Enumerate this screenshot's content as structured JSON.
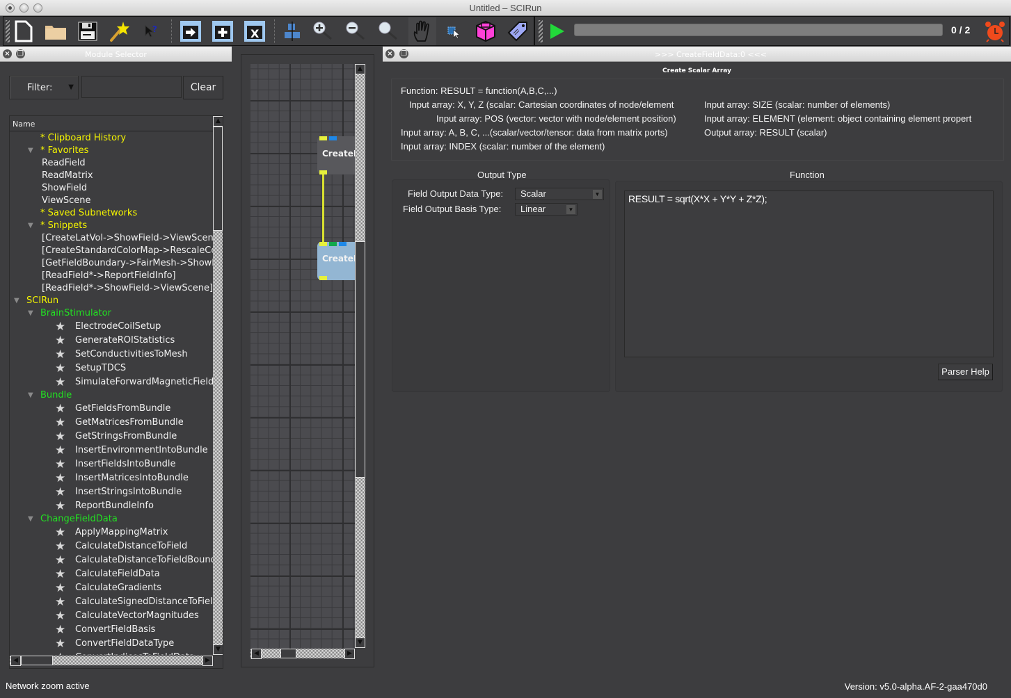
{
  "window": {
    "title": "Untitled – SCIRun"
  },
  "toolbar": {
    "buttons": [
      {
        "name": "new-network",
        "icon": "new-file-icon"
      },
      {
        "name": "open-network",
        "icon": "folder-icon"
      },
      {
        "name": "save-network",
        "icon": "floppy-disk-icon"
      },
      {
        "name": "wizard",
        "icon": "magic-wand-icon"
      },
      {
        "name": "whats-this",
        "icon": "help-cursor-icon"
      },
      {
        "name": "execute-module",
        "icon": "arrow-window-icon"
      },
      {
        "name": "add-module",
        "icon": "plus-window-icon"
      },
      {
        "name": "delete-module",
        "icon": "x-window-icon"
      },
      {
        "name": "align",
        "icon": "align-icon"
      },
      {
        "name": "zoom-in",
        "icon": "zoom-in-icon"
      },
      {
        "name": "zoom-out",
        "icon": "zoom-out-icon"
      },
      {
        "name": "zoom-reset",
        "icon": "magnifier-icon"
      },
      {
        "name": "pan",
        "icon": "hand-icon"
      },
      {
        "name": "select",
        "icon": "select-cursor-icon"
      },
      {
        "name": "subnet",
        "icon": "cube-icon"
      },
      {
        "name": "tag",
        "icon": "tag-icon"
      },
      {
        "name": "execute-all",
        "icon": "play-icon"
      }
    ],
    "progress": {
      "completed": 0,
      "total": 2,
      "fraction": 0.0
    },
    "counter_text": "0 / 2",
    "alarm_icon": "alarm-clock-icon"
  },
  "module_selector": {
    "title": "Module Selector",
    "filter_label": "Filter:",
    "filter_value": "",
    "clear_label": "Clear",
    "column_header": "Name",
    "items": [
      {
        "level": 1,
        "expander": false,
        "color": "yellow",
        "star": false,
        "label": "* Clipboard History"
      },
      {
        "level": 1,
        "expander": true,
        "color": "yellow",
        "star": false,
        "label": "* Favorites"
      },
      {
        "level": 2,
        "expander": false,
        "color": "white",
        "star": false,
        "label": "ReadField"
      },
      {
        "level": 2,
        "expander": false,
        "color": "white",
        "star": false,
        "label": "ReadMatrix"
      },
      {
        "level": 2,
        "expander": false,
        "color": "white",
        "star": false,
        "label": "ShowField"
      },
      {
        "level": 2,
        "expander": false,
        "color": "white",
        "star": false,
        "label": "ViewScene"
      },
      {
        "level": 1,
        "expander": false,
        "color": "yellow",
        "star": false,
        "label": "* Saved Subnetworks"
      },
      {
        "level": 1,
        "expander": true,
        "color": "yellow",
        "star": false,
        "label": "* Snippets"
      },
      {
        "level": 2,
        "expander": false,
        "color": "white",
        "star": false,
        "label": "[CreateLatVol->ShowField->ViewScene]"
      },
      {
        "level": 2,
        "expander": false,
        "color": "white",
        "star": false,
        "label": "[CreateStandardColorMap->RescaleColorMap]"
      },
      {
        "level": 2,
        "expander": false,
        "color": "white",
        "star": false,
        "label": "[GetFieldBoundary->FairMesh->ShowField]"
      },
      {
        "level": 2,
        "expander": false,
        "color": "white",
        "star": false,
        "label": "[ReadField*->ReportFieldInfo]"
      },
      {
        "level": 2,
        "expander": false,
        "color": "white",
        "star": false,
        "label": "[ReadField*->ShowField->ViewScene]"
      },
      {
        "level": 0,
        "expander": true,
        "color": "yellow",
        "star": false,
        "label": "SCIRun"
      },
      {
        "level": 1,
        "expander": true,
        "color": "green",
        "star": false,
        "label": "BrainStimulator"
      },
      {
        "level": 2,
        "expander": false,
        "color": "white",
        "star": true,
        "label": "ElectrodeCoilSetup"
      },
      {
        "level": 2,
        "expander": false,
        "color": "white",
        "star": true,
        "label": "GenerateROIStatistics"
      },
      {
        "level": 2,
        "expander": false,
        "color": "white",
        "star": true,
        "label": "SetConductivitiesToMesh"
      },
      {
        "level": 2,
        "expander": false,
        "color": "white",
        "star": true,
        "label": "SetupTDCS"
      },
      {
        "level": 2,
        "expander": false,
        "color": "white",
        "star": true,
        "label": "SimulateForwardMagneticField"
      },
      {
        "level": 1,
        "expander": true,
        "color": "green",
        "star": false,
        "label": "Bundle"
      },
      {
        "level": 2,
        "expander": false,
        "color": "white",
        "star": true,
        "label": "GetFieldsFromBundle"
      },
      {
        "level": 2,
        "expander": false,
        "color": "white",
        "star": true,
        "label": "GetMatricesFromBundle"
      },
      {
        "level": 2,
        "expander": false,
        "color": "white",
        "star": true,
        "label": "GetStringsFromBundle"
      },
      {
        "level": 2,
        "expander": false,
        "color": "white",
        "star": true,
        "label": "InsertEnvironmentIntoBundle"
      },
      {
        "level": 2,
        "expander": false,
        "color": "white",
        "star": true,
        "label": "InsertFieldsIntoBundle"
      },
      {
        "level": 2,
        "expander": false,
        "color": "white",
        "star": true,
        "label": "InsertMatricesIntoBundle"
      },
      {
        "level": 2,
        "expander": false,
        "color": "white",
        "star": true,
        "label": "InsertStringsIntoBundle"
      },
      {
        "level": 2,
        "expander": false,
        "color": "white",
        "star": true,
        "label": "ReportBundleInfo"
      },
      {
        "level": 1,
        "expander": true,
        "color": "green",
        "star": false,
        "label": "ChangeFieldData"
      },
      {
        "level": 2,
        "expander": false,
        "color": "white",
        "star": true,
        "label": "ApplyMappingMatrix"
      },
      {
        "level": 2,
        "expander": false,
        "color": "white",
        "star": true,
        "label": "CalculateDistanceToField"
      },
      {
        "level": 2,
        "expander": false,
        "color": "white",
        "star": true,
        "label": "CalculateDistanceToFieldBoundary"
      },
      {
        "level": 2,
        "expander": false,
        "color": "white",
        "star": true,
        "label": "CalculateFieldData"
      },
      {
        "level": 2,
        "expander": false,
        "color": "white",
        "star": true,
        "label": "CalculateGradients"
      },
      {
        "level": 2,
        "expander": false,
        "color": "white",
        "star": true,
        "label": "CalculateSignedDistanceToField"
      },
      {
        "level": 2,
        "expander": false,
        "color": "white",
        "star": true,
        "label": "CalculateVectorMagnitudes"
      },
      {
        "level": 2,
        "expander": false,
        "color": "white",
        "star": true,
        "label": "ConvertFieldBasis"
      },
      {
        "level": 2,
        "expander": false,
        "color": "white",
        "star": true,
        "label": "ConvertFieldDataType"
      },
      {
        "level": 2,
        "expander": false,
        "color": "white",
        "star": true,
        "label": "ConvertIndicesToFieldData"
      }
    ]
  },
  "network": {
    "nodes": [
      {
        "label": "CreateLatVol",
        "selected": false
      },
      {
        "label": "CreateFieldData",
        "selected": true
      }
    ],
    "colors": {
      "field_port": "#e6f03c",
      "matrix_port": "#1e88e8",
      "string_port": "#11a84a",
      "selected_node": "#93b6d3",
      "node": "#58585c"
    }
  },
  "module_ui": {
    "title": ">>> CreateFieldData:0 <<<",
    "subtitle": "Create Scalar Array",
    "doc_left": [
      "Function: RESULT = function(A,B,C,...)",
      "Input array: X, Y, Z (scalar: Cartesian coordinates of node/element",
      "Input array: POS (vector: vector with node/element position)",
      "Input array: A, B, C, ...(scalar/vector/tensor: data from matrix ports)",
      "Input array: INDEX (scalar: number of the element)"
    ],
    "doc_right": [
      "Input array: SIZE (scalar: number of elements)",
      "Input array: ELEMENT (element: object containing element propert",
      "Output array: RESULT (scalar)"
    ],
    "output_type": {
      "title": "Output Type",
      "data_type_label": "Field Output Data Type:",
      "data_type_value": "Scalar",
      "basis_type_label": "Field Output Basis Type:",
      "basis_type_value": "Linear"
    },
    "function": {
      "title": "Function",
      "text": "RESULT = sqrt(X*X + Y*Y + Z*Z);",
      "parser_help_label": "Parser Help"
    }
  },
  "statusbar": {
    "message": "Network zoom active",
    "version": "Version: v5.0-alpha.AF-2-gaa470d0"
  }
}
